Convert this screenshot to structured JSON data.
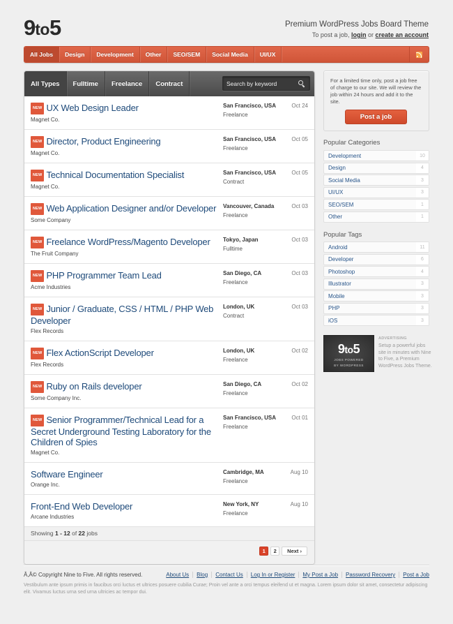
{
  "header": {
    "logo_main": "9",
    "logo_to": "to",
    "logo_end": "5",
    "tagline": "Premium WordPress Jobs Board Theme",
    "post_prefix": "To post a job, ",
    "login": "login",
    "or": " or ",
    "create_account": "create an account"
  },
  "nav": {
    "items": [
      "All Jobs",
      "Design",
      "Development",
      "Other",
      "SEO/SEM",
      "Social Media",
      "UI/UX"
    ],
    "active": "All Jobs",
    "rss_icon": "rss-icon"
  },
  "filters": {
    "tabs": [
      "All Types",
      "Fulltime",
      "Freelance",
      "Contract"
    ],
    "active": "All Types",
    "search_placeholder": "Search by keyword",
    "search_icon": "magnifier-icon"
  },
  "jobs": [
    {
      "new": true,
      "title": "UX Web Design Leader",
      "company": "Magnet Co.",
      "location": "San Francisco, USA",
      "type": "Freelance",
      "date": "Oct 24"
    },
    {
      "new": true,
      "title": "Director, Product Engineering",
      "company": "Magnet Co.",
      "location": "San Francisco, USA",
      "type": "Freelance",
      "date": "Oct 05"
    },
    {
      "new": true,
      "title": "Technical Documentation Specialist",
      "company": "Magnet Co.",
      "location": "San Francisco, USA",
      "type": "Contract",
      "date": "Oct 05"
    },
    {
      "new": true,
      "title": "Web Application Designer and/or Developer",
      "company": "Some Company",
      "location": "Vancouver, Canada",
      "type": "Freelance",
      "date": "Oct 03"
    },
    {
      "new": true,
      "title": "Freelance WordPress/Magento Developer",
      "company": "The Fruit Company",
      "location": "Tokyo, Japan",
      "type": "Fulltime",
      "date": "Oct 03"
    },
    {
      "new": true,
      "title": "PHP Programmer Team Lead",
      "company": "Acme Industries",
      "location": "San Diego, CA",
      "type": "Freelance",
      "date": "Oct 03"
    },
    {
      "new": true,
      "title": "Junior / Graduate, CSS / HTML / PHP Web Developer",
      "company": "Flex Records",
      "location": "London, UK",
      "type": "Contract",
      "date": "Oct 03"
    },
    {
      "new": true,
      "title": "Flex ActionScript Developer",
      "company": "Flex Records",
      "location": "London, UK",
      "type": "Freelance",
      "date": "Oct 02"
    },
    {
      "new": true,
      "title": "Ruby on Rails developer",
      "company": "Some Company Inc.",
      "location": "San Diego, CA",
      "type": "Freelance",
      "date": "Oct 02"
    },
    {
      "new": true,
      "title": "Senior Programmer/Technical Lead for a Secret Underground Testing Laboratory for the Children of Spies",
      "company": "Magnet Co.",
      "location": "San Francisco, USA",
      "type": "Freelance",
      "date": "Oct 01"
    },
    {
      "new": false,
      "title": "Software Engineer",
      "company": "Orange Inc.",
      "location": "Cambridge, MA",
      "type": "Freelance",
      "date": "Aug 10"
    },
    {
      "new": false,
      "title": "Front-End Web Developer",
      "company": "Arcane Industries",
      "location": "New York, NY",
      "type": "Freelance",
      "date": "Aug 10"
    }
  ],
  "badge_label": "NEW",
  "showing": {
    "prefix": "Showing ",
    "from": "1",
    "dash": " - ",
    "to": "12",
    "of": " of ",
    "total": "22",
    "suffix": " jobs"
  },
  "pagination": {
    "pages": [
      "1",
      "2"
    ],
    "current": "1",
    "next": "Next ›"
  },
  "sidebar": {
    "promo_text": "For a limited time only, post a job free of charge to our site. We will review the job within 24 hours and add it to the site.",
    "post_job_label": "Post a job",
    "categories_heading": "Popular Categories",
    "categories": [
      {
        "label": "Development",
        "count": "10"
      },
      {
        "label": "Design",
        "count": "4"
      },
      {
        "label": "Social Media",
        "count": "3"
      },
      {
        "label": "UI/UX",
        "count": "3"
      },
      {
        "label": "SEO/SEM",
        "count": "1"
      },
      {
        "label": "Other",
        "count": "1"
      }
    ],
    "tags_heading": "Popular Tags",
    "tags": [
      {
        "label": "Android",
        "count": "11"
      },
      {
        "label": "Developer",
        "count": "6"
      },
      {
        "label": "Photoshop",
        "count": "4"
      },
      {
        "label": "Illustrator",
        "count": "3"
      },
      {
        "label": "Mobile",
        "count": "3"
      },
      {
        "label": "PHP",
        "count": "3"
      },
      {
        "label": "iOS",
        "count": "3"
      }
    ],
    "ad": {
      "logo_main": "9",
      "logo_to": "to",
      "logo_end": "5",
      "sub_line1": "JOBS POWERED",
      "sub_line2": "BY WORDPRESS",
      "label": "ADVERTISING",
      "text": "Setup a powerful jobs site in minutes with Nine to Five, a Premium WordPress Jobs Theme."
    }
  },
  "footer": {
    "copyright": "Â,Â© Copyright Nine to Five. All rights reserved.",
    "links": [
      "About Us",
      "Blog",
      "Contact Us",
      "Log In or Register",
      "My Post a Job",
      "Password Recovery",
      "Post a Job"
    ],
    "note": "Vestibulum ante ipsum primis in faucibus orci luctus et ultrices posuere cubilia Curae; Proin vel ante a orci tempus eleifend ut et magna. Lorem ipsum dolor sit amet, consectetur adipiscing elit. Vivamus luctus urna sed urna ultricies ac tempor dui."
  },
  "colors": {
    "accent": "#d9543a",
    "link": "#1d4c7e",
    "filter_bar": "#555555",
    "background": "#efefef"
  }
}
